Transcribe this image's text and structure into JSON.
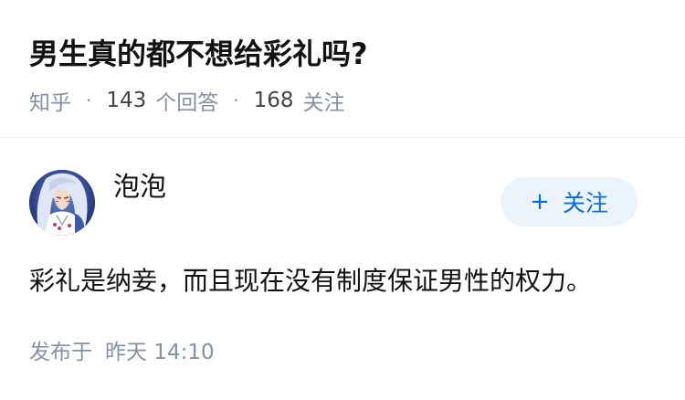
{
  "question": {
    "title": "男生真的都不想给彩礼吗?",
    "source": "知乎",
    "answer_count": "143",
    "answer_label": "个回答",
    "follower_count": "168",
    "follower_label": "关注"
  },
  "answer": {
    "author": {
      "name": "泡泡",
      "avatar_icon": "anime-character-avatar"
    },
    "follow_button": {
      "icon": "plus-icon",
      "plus": "+",
      "label": "关注"
    },
    "content": "彩礼是纳妾，而且现在没有制度保证男性的权力。",
    "published_label": "发布于",
    "published_time": "昨天 14:10"
  },
  "colors": {
    "accent": "#056de8",
    "accent_bg": "#ebf3fb",
    "meta": "#8590a6",
    "text": "#121212"
  }
}
